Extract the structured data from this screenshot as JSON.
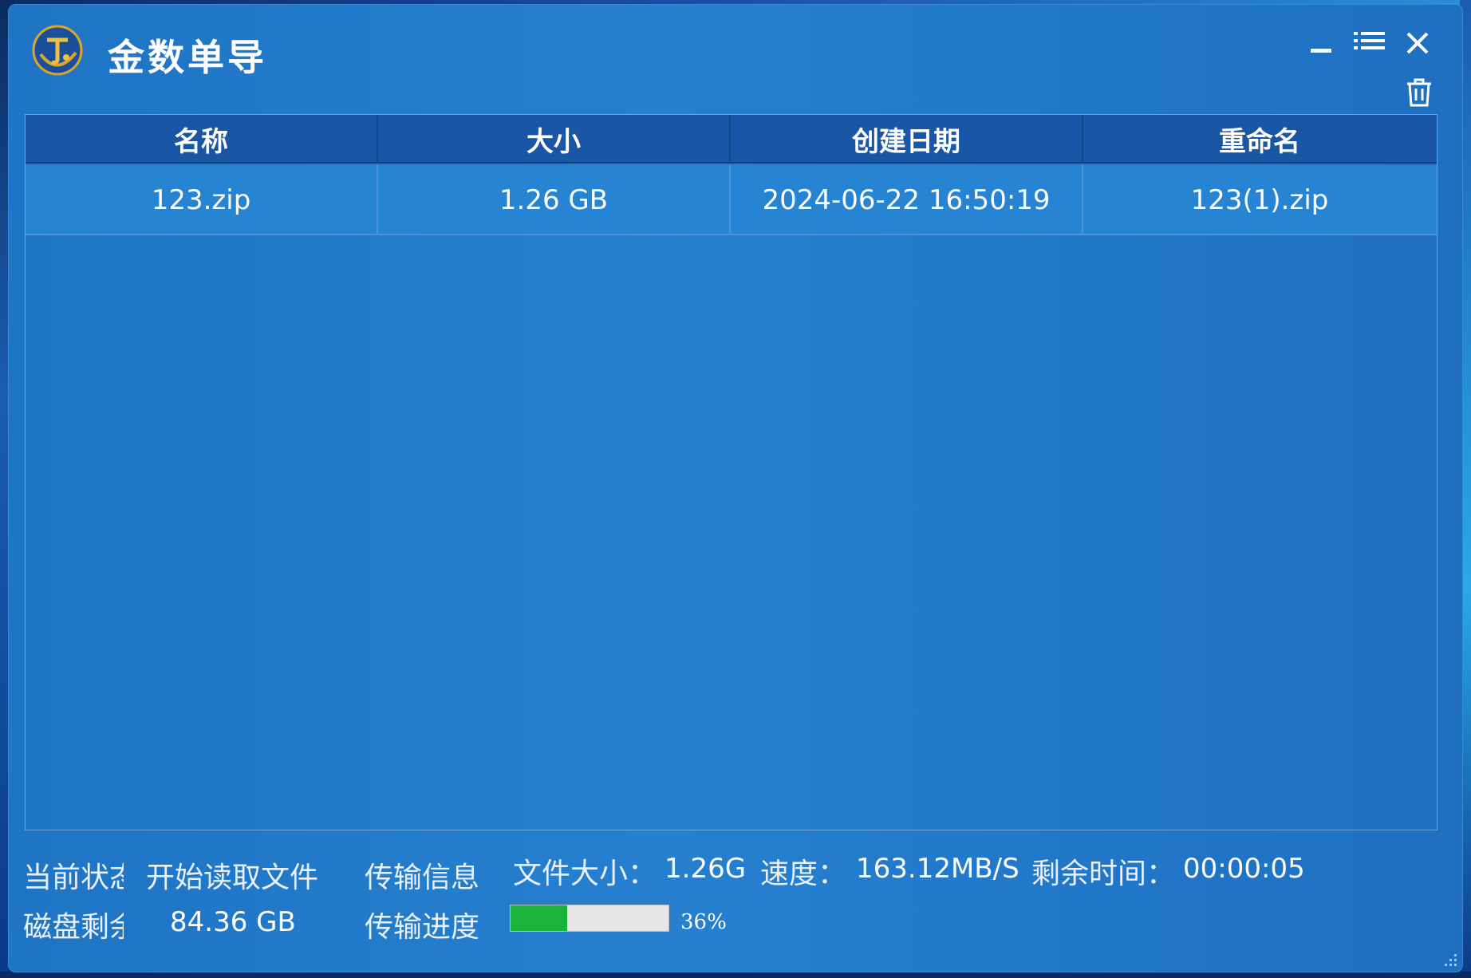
{
  "app": {
    "title": "金数单导",
    "accent_color": "#1f74c4",
    "header_color": "#1a56a6"
  },
  "window_controls": {
    "minimize_icon": "minimize-icon",
    "menu_icon": "list-menu-icon",
    "close_icon": "close-icon",
    "trash_icon": "trash-icon"
  },
  "table": {
    "columns": [
      "名称",
      "大小",
      "创建日期",
      "重命名"
    ],
    "rows": [
      [
        "123.zip",
        "1.26 GB",
        "2024-06-22 16:50:19",
        "123(1).zip"
      ]
    ]
  },
  "status": {
    "current_state_label": "当前状态",
    "current_state_value": "开始读取文件",
    "transfer_info_label": "传输信息",
    "file_size_label": "文件大小：",
    "file_size_value": "1.26G",
    "speed_label": "速度：",
    "speed_value": "163.12MB/S",
    "remaining_time_label": "剩余时间：",
    "remaining_time_value": "00:00:05",
    "disk_remaining_label": "磁盘剩余",
    "disk_remaining_value": "84.36 GB",
    "transfer_progress_label": "传输进度",
    "progress_percent": 36,
    "progress_text": "36%",
    "progress_color": "#1bb43a"
  }
}
